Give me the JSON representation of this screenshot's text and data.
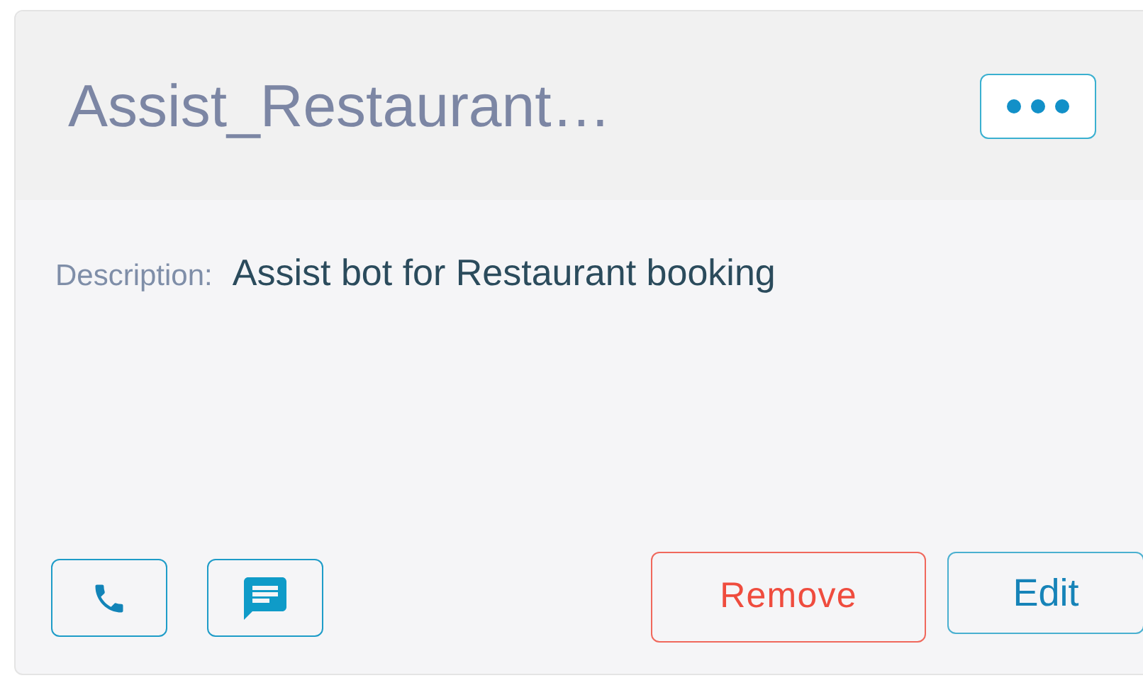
{
  "card": {
    "title": "Assist_Restaurant…",
    "description_label": "Description:",
    "description": "Assist bot for Restaurant booking",
    "buttons": [
      {
        "kind": "remove",
        "label": "Remove"
      },
      {
        "kind": "edit",
        "label": "Edit"
      }
    ],
    "channels": [
      {
        "kind": "phone"
      },
      {
        "kind": "chat"
      }
    ]
  }
}
